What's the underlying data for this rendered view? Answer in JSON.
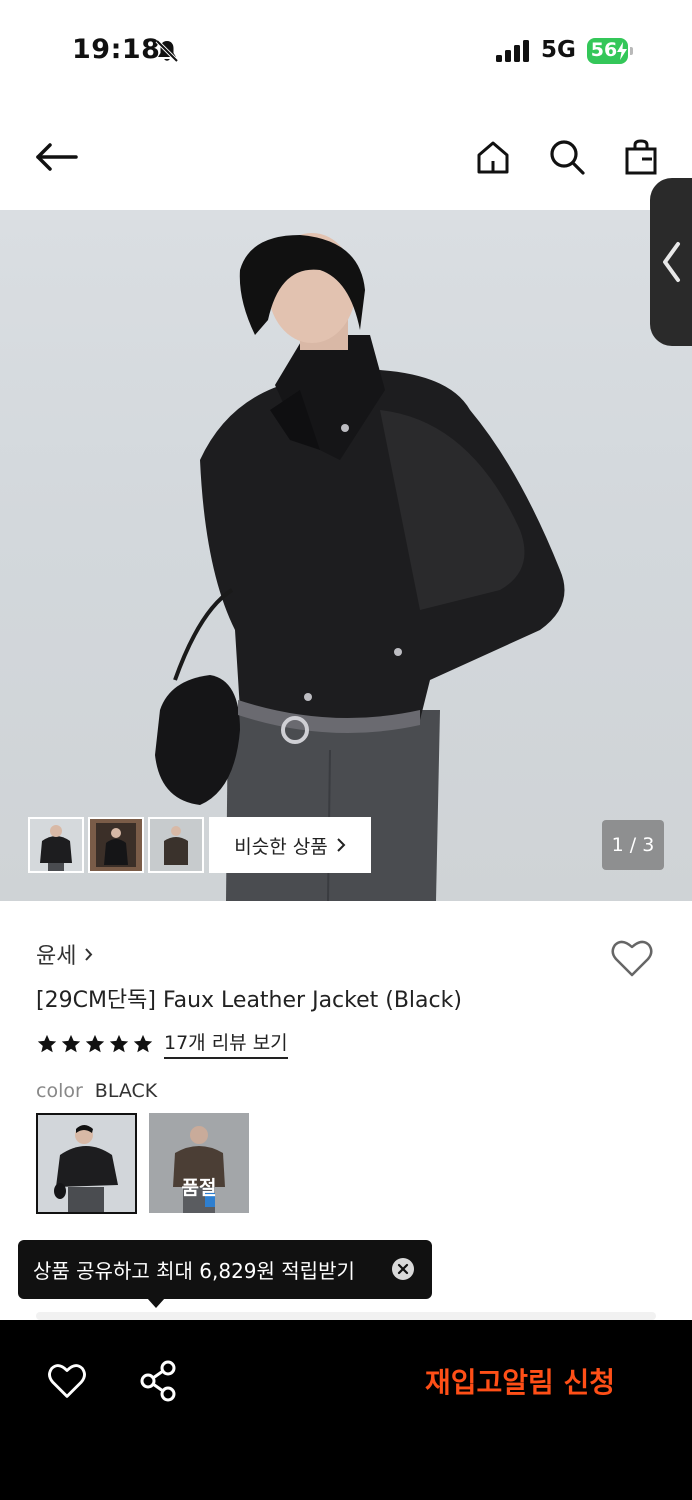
{
  "status_bar": {
    "time": "19:18",
    "network": "5G",
    "battery": "56",
    "icons": [
      "bell-slash-icon",
      "signal-icon",
      "battery-charging-icon"
    ],
    "battery_color": "#34c759"
  },
  "nav": {
    "icons": [
      "arrow-left-icon",
      "home-icon",
      "search-icon",
      "shopping-bag-icon"
    ]
  },
  "gallery": {
    "similar_label": "비슷한 상품",
    "page_counter": "1 / 3",
    "thumbnail_count": 3
  },
  "product": {
    "brand": "윤세",
    "title": "[29CM단독] Faux Leather Jacket (Black)",
    "rating_stars": 5,
    "review_link": "17개 리뷰 보기",
    "color_label": "color",
    "color_value": "BLACK",
    "soldout_label": "품절"
  },
  "tooltip": {
    "text": "상품 공유하고 최대 6,829원 적립받기"
  },
  "bottom_bar": {
    "restock_label": "재입고알림 신청",
    "accent_color": "#ff4f17"
  }
}
